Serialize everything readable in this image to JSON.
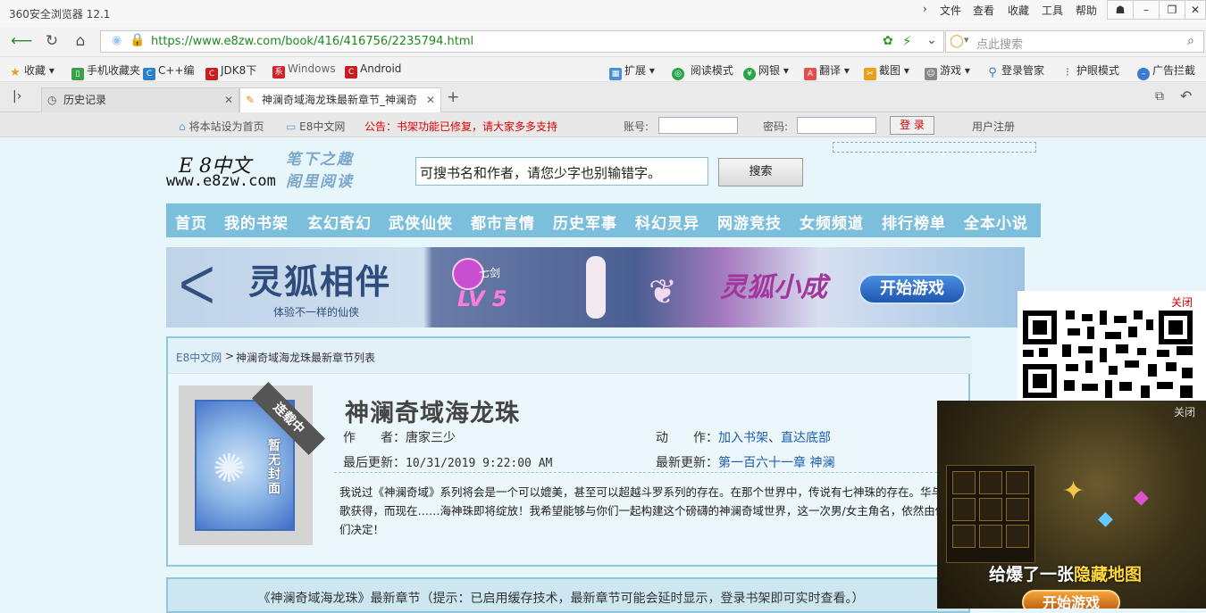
{
  "browser": {
    "title": "360安全浏览器 12.1",
    "menus": [
      "文件",
      "查看",
      "收藏",
      "工具",
      "帮助"
    ],
    "url_prefix": "https://",
    "url_rest": "www.e8zw.com/book/416/416756/2235794.html",
    "search_placeholder": "点此搜索",
    "favorites": [
      "收藏",
      "手机收藏夹",
      "C++编",
      "JDK8下",
      "Windows",
      "Android"
    ],
    "toolbar_right": [
      "扩展",
      "阅读模式",
      "网银",
      "翻译",
      "截图",
      "游戏",
      "登录管家",
      "护眼模式",
      "广告拦截"
    ],
    "tabs": [
      {
        "label": "历史记录"
      },
      {
        "label": "神澜奇域海龙珠最新章节_神澜奇"
      }
    ]
  },
  "site": {
    "top": {
      "set_home": "将本站设为首页",
      "site_link": "E8中文网",
      "notice": "公告：书架功能已修复，请大家多多支持",
      "account_label": "账号:",
      "password_label": "密码:",
      "login_label": "登 录",
      "register_label": "用户注册"
    },
    "logo_line1": "E 8中文",
    "logo_line2": "www.e8zw.com",
    "slogan_line1": "笔下之趣",
    "slogan_line2": "阁里阅读",
    "search_value": "可搜书名和作者，请您少字也别输错字。",
    "search_button": "搜索",
    "nav": [
      "首页",
      "我的书架",
      "玄幻奇幻",
      "武侠仙侠",
      "都市言情",
      "历史军事",
      "科幻灵异",
      "网游竞技",
      "女频频道",
      "排行榜单",
      "全本小说"
    ]
  },
  "banner": {
    "title": "灵狐相伴",
    "subtitle": "体验不一样的仙侠",
    "sword": "七剑",
    "level": "LV 5",
    "mid": "灵狐小成",
    "cta": "开始游戏"
  },
  "book": {
    "breadcrumb_home": "E8中文网",
    "breadcrumb_sep": ">",
    "breadcrumb_current": "神澜奇域海龙珠最新章节列表",
    "ribbon": "连载中",
    "no_cover": "暂无封面",
    "title": "神澜奇域海龙珠",
    "author_label": "作　　者：",
    "author": "唐家三少",
    "action_label": "动　　作：",
    "action_shelf": "加入书架",
    "action_sep": "、",
    "action_bottom": "直达底部",
    "updated_label": "最后更新：",
    "updated": "10/31/2019 9:22:00 AM",
    "latest_label": "最新更新：",
    "latest": "第一百六十一章 神澜",
    "description": "我说过《神澜奇域》系列将会是一个可以媲美，甚至可以超越斗罗系列的存在。在那个世界中，传说有七神珠的存在。华与蓝歌获得，而现在……海神珠即将绽放！我希望能够与你们一起构建这个磅礴的神澜奇域世界，这一次男/女主角名，依然由你们决定！",
    "chapter_note": "《神澜奇域海龙珠》最新章节（提示：已启用缓存技术，最新章节可能会延时显示，登录书架即可实时查看。）"
  },
  "ads": {
    "qr_close": "关闭",
    "game_close": "关闭",
    "game_text_pre": "给爆了一张",
    "game_text_hl": "隐藏地图",
    "game_cta": "开始游戏"
  }
}
